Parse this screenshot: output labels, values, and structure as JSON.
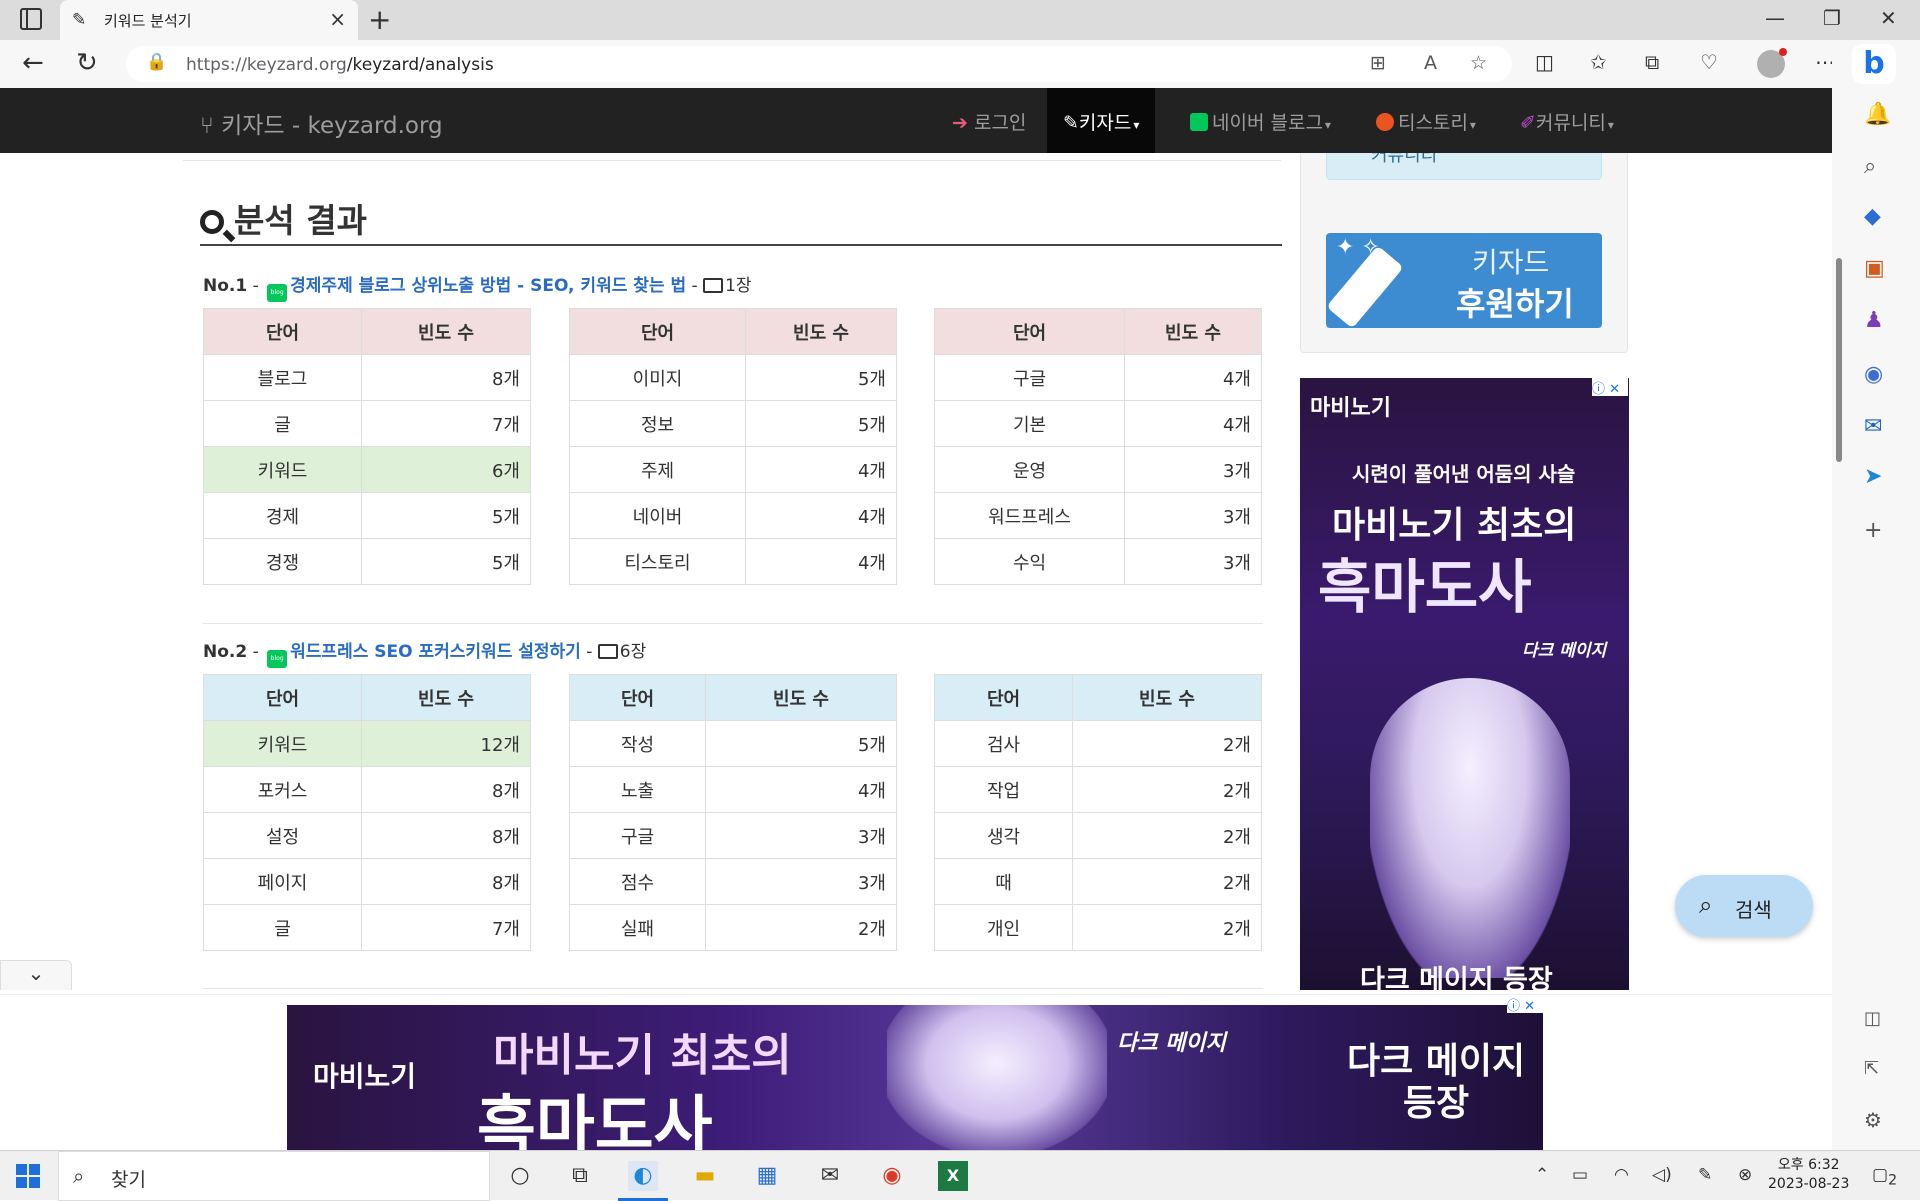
{
  "browser": {
    "tab_title": "키워드 분석기",
    "url_host": "https://keyzard.org",
    "url_path": "/keyzard/analysis"
  },
  "site_nav": {
    "brand": "키자드 - keyzard.org",
    "login": "로그인",
    "keyzard": "키자드",
    "naver_blog": "네이버 블로그",
    "tistory": "티스토리",
    "community": "커뮤니티"
  },
  "sidebar": {
    "community_label": "커뮤니티",
    "donate_line1": "키자드",
    "donate_line2": "후원하기"
  },
  "section_title": "분석 결과",
  "table_headers": {
    "word": "단어",
    "freq": "빈도 수"
  },
  "results": [
    {
      "no": "No.1",
      "title": "경제주제 블로그 상위노출 방법 - SEO, 키워드 찾는 법",
      "images": "1장",
      "tables": [
        [
          [
            "블로그",
            "8개"
          ],
          [
            "글",
            "7개"
          ],
          [
            "키워드",
            "6개"
          ],
          [
            "경제",
            "5개"
          ],
          [
            "경쟁",
            "5개"
          ]
        ],
        [
          [
            "이미지",
            "5개"
          ],
          [
            "정보",
            "5개"
          ],
          [
            "주제",
            "4개"
          ],
          [
            "네이버",
            "4개"
          ],
          [
            "티스토리",
            "4개"
          ]
        ],
        [
          [
            "구글",
            "4개"
          ],
          [
            "기본",
            "4개"
          ],
          [
            "운영",
            "3개"
          ],
          [
            "워드프레스",
            "3개"
          ],
          [
            "수익",
            "3개"
          ]
        ]
      ]
    },
    {
      "no": "No.2",
      "title": "워드프레스 SEO 포커스키워드 설정하기",
      "images": "6장",
      "tables": [
        [
          [
            "키워드",
            "12개"
          ],
          [
            "포커스",
            "8개"
          ],
          [
            "설정",
            "8개"
          ],
          [
            "페이지",
            "8개"
          ],
          [
            "글",
            "7개"
          ]
        ],
        [
          [
            "작성",
            "5개"
          ],
          [
            "노출",
            "4개"
          ],
          [
            "구글",
            "3개"
          ],
          [
            "점수",
            "3개"
          ],
          [
            "실패",
            "2개"
          ]
        ],
        [
          [
            "검사",
            "2개"
          ],
          [
            "작업",
            "2개"
          ],
          [
            "생각",
            "2개"
          ],
          [
            "때",
            "2개"
          ],
          [
            "개인",
            "2개"
          ]
        ]
      ]
    }
  ],
  "side_ad": {
    "logo": "마비노기",
    "line1": "시련이 풀어낸 어둠의 사슬",
    "line2": "마비노기 최초의",
    "line3": "흑마도사",
    "line4": "다크 메이지",
    "line5": "다크 메이지 등장"
  },
  "bottom_ad": {
    "logo": "마비노기",
    "line1": "마비노기 최초의",
    "line2": "흑마도사",
    "line3": "다크 메이지",
    "line4a": "다크 메이지",
    "line4b": "등장"
  },
  "float_search": "검색",
  "taskbar": {
    "search_placeholder": "찾기",
    "time": "오후 6:32",
    "date": "2023-08-23",
    "notifications": "2"
  }
}
